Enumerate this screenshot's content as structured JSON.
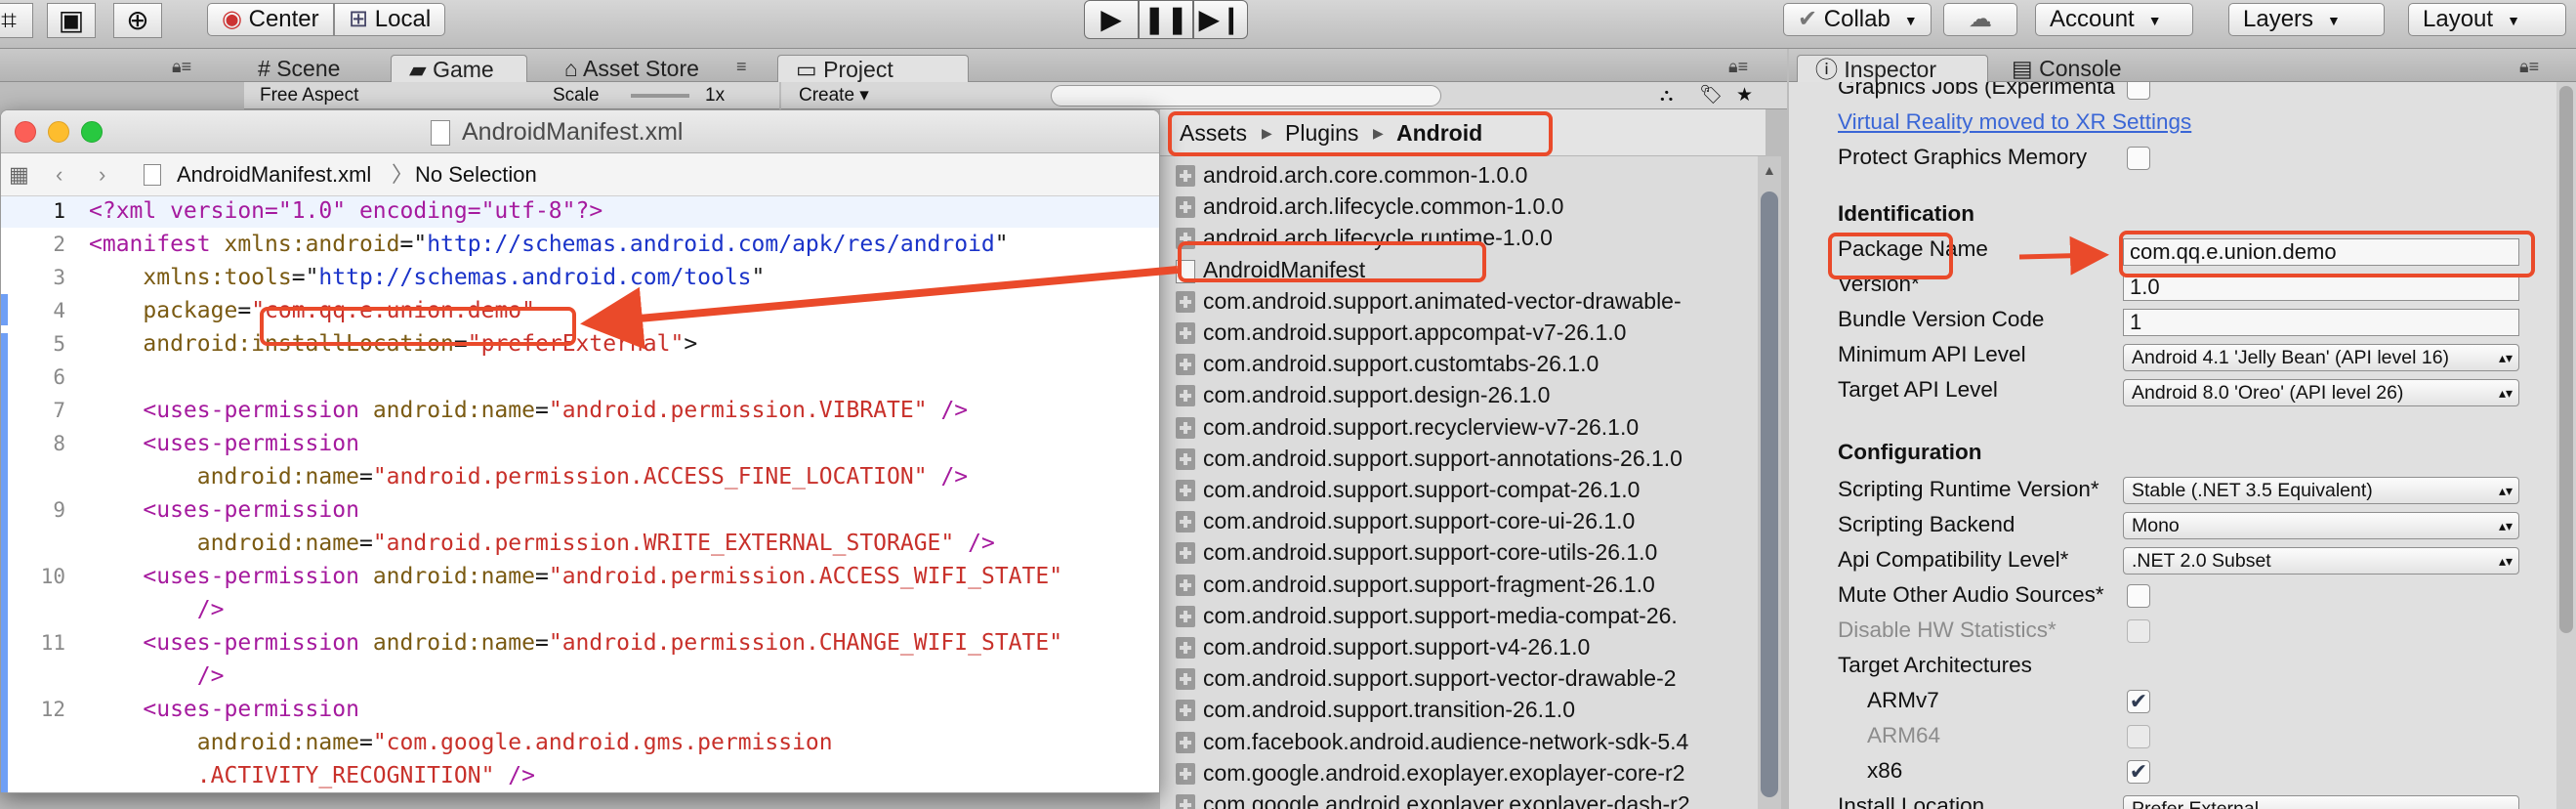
{
  "toolbar": {
    "pivot_center": "Center",
    "pivot_local": "Local",
    "collab": "Collab",
    "account": "Account",
    "layers": "Layers",
    "layout": "Layout"
  },
  "tabs": {
    "scene": "Scene",
    "game": "Game",
    "asset_store": "Asset Store",
    "project": "Project",
    "inspector": "Inspector",
    "console": "Console"
  },
  "game_bar": {
    "aspect": "Free Aspect",
    "scale_label": "Scale",
    "scale_value": "1x"
  },
  "project_bar": {
    "create": "Create"
  },
  "xcode": {
    "title": "AndroidManifest.xml",
    "jump_file": "AndroidManifest.xml",
    "jump_selection": "No Selection",
    "lines": [
      {
        "n": "1"
      },
      {
        "n": "2"
      },
      {
        "n": "3"
      },
      {
        "n": "4"
      },
      {
        "n": "5"
      },
      {
        "n": "6"
      },
      {
        "n": "7"
      },
      {
        "n": "8"
      },
      {
        "n": "9"
      },
      {
        "n": "10"
      },
      {
        "n": "11"
      },
      {
        "n": "12"
      }
    ],
    "code": {
      "l1": "<?xml version=\"1.0\" encoding=\"utf-8\"?>",
      "l2_tag": "<manifest",
      "l2_attr": "xmlns:android",
      "l2_val": "http://schemas.android.com/apk/res/android",
      "l3_attr": "xmlns:tools",
      "l3_val": "http://schemas.android.com/tools",
      "l4_attr": "package",
      "l4_val": "com.qq.e.union.demo",
      "l5_attr": "android:installLocation",
      "l5_val": "preferExternal",
      "uses_permission": "<uses-permission",
      "attr_name": "android:name",
      "close_tag": "/>",
      "p_vibrate": "android.permission.VIBRATE",
      "p_fine_location": "android.permission.ACCESS_FINE_LOCATION",
      "p_write_storage": "android.permission.WRITE_EXTERNAL_STORAGE",
      "p_access_wifi": "android.permission.ACCESS_WIFI_STATE",
      "p_change_wifi": "android.permission.CHANGE_WIFI_STATE",
      "p_gms_1": "com.google.android.gms.permission",
      "p_gms_2": ".ACTIVITY_RECOGNITION"
    }
  },
  "project": {
    "breadcrumb": [
      "Assets",
      "Plugins",
      "Android"
    ],
    "items": [
      "android.arch.core.common-1.0.0",
      "android.arch.lifecycle.common-1.0.0",
      "android.arch.lifecycle.runtime-1.0.0",
      "AndroidManifest",
      "com.android.support.animated-vector-drawable-",
      "com.android.support.appcompat-v7-26.1.0",
      "com.android.support.customtabs-26.1.0",
      "com.android.support.design-26.1.0",
      "com.android.support.recyclerview-v7-26.1.0",
      "com.android.support.support-annotations-26.1.0",
      "com.android.support.support-compat-26.1.0",
      "com.android.support.support-core-ui-26.1.0",
      "com.android.support.support-core-utils-26.1.0",
      "com.android.support.support-fragment-26.1.0",
      "com.android.support.support-media-compat-26.",
      "com.android.support.support-v4-26.1.0",
      "com.android.support.support-vector-drawable-2",
      "com.android.support.transition-26.1.0",
      "com.facebook.android.audience-network-sdk-5.4",
      "com.google.android.exoplayer.exoplayer-core-r2",
      "com.google.android.exoplayer.exoplayer-dash-r2"
    ]
  },
  "inspector": {
    "graphics_jobs": "Graphics Jobs (Experimenta",
    "vr_link": "Virtual Reality moved to XR Settings",
    "protect_graphics_memory": "Protect Graphics Memory",
    "identification_header": "Identification",
    "package_name_label": "Package Name",
    "package_name_value": "com.qq.e.union.demo",
    "version_label": "Version*",
    "version_value": "1.0",
    "bundle_code_label": "Bundle Version Code",
    "bundle_code_value": "1",
    "min_api_label": "Minimum API Level",
    "min_api_value": "Android 4.1 'Jelly Bean' (API level 16)",
    "target_api_label": "Target API Level",
    "target_api_value": "Android 8.0 'Oreo' (API level 26)",
    "configuration_header": "Configuration",
    "runtime_label": "Scripting Runtime Version*",
    "runtime_value": "Stable (.NET 3.5 Equivalent)",
    "backend_label": "Scripting Backend",
    "backend_value": "Mono",
    "api_compat_label": "Api Compatibility Level*",
    "api_compat_value": ".NET 2.0 Subset",
    "mute_audio_label": "Mute Other Audio Sources*",
    "disable_hw_label": "Disable HW Statistics*",
    "target_arch_label": "Target Architectures",
    "armv7_label": "ARMv7",
    "arm64_label": "ARM64",
    "x86_label": "x86",
    "install_location_label": "Install Location",
    "install_location_value": "Prefer External",
    "checked_mark": "✔"
  },
  "colors": {
    "annotation": "#ea4a2a",
    "link": "#3a66d6",
    "xml_tag": "#a51a9e",
    "xml_attr": "#7a5a12",
    "xml_string": "#c8302a",
    "xml_url": "#1a33c9"
  }
}
